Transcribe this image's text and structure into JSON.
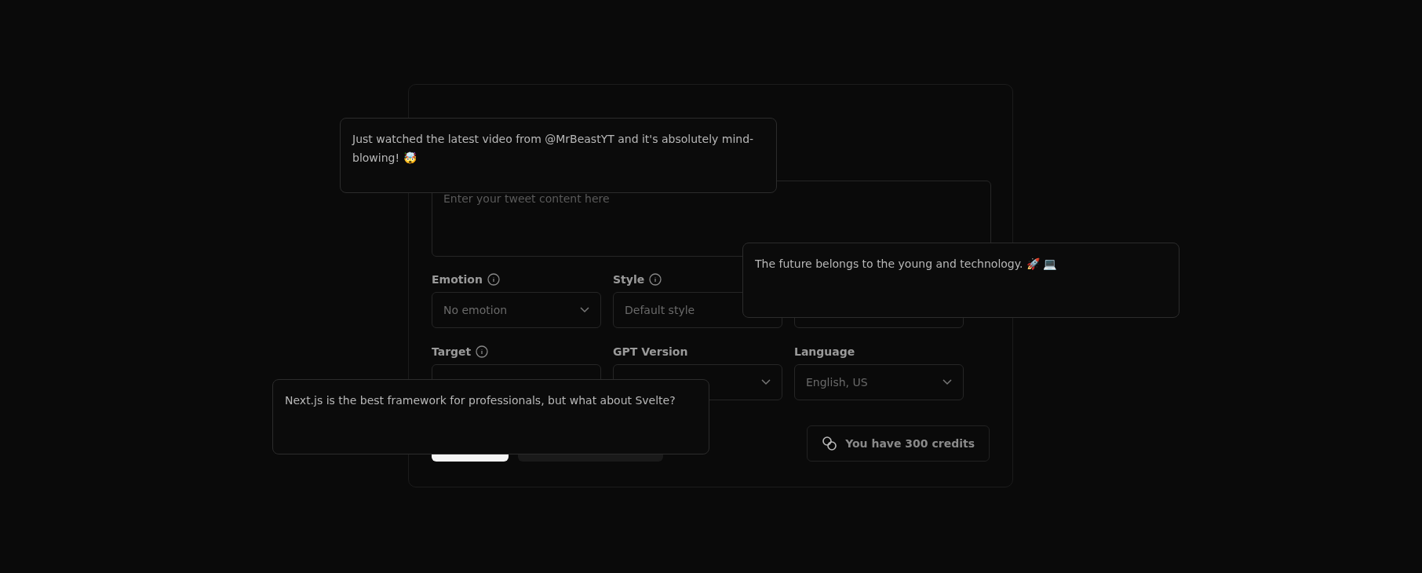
{
  "form": {
    "tweet_field": {
      "placeholder": "Enter your tweet content here"
    },
    "fields": [
      {
        "kind": "select",
        "label": "Emotion",
        "info": true,
        "value": "No emotion"
      },
      {
        "kind": "select",
        "label": "Style",
        "info": true,
        "value": "Default style"
      },
      {
        "kind": "select"
      },
      {
        "kind": "select",
        "label": "Target",
        "info": true
      },
      {
        "kind": "select",
        "label": "GPT Version",
        "info": false
      },
      {
        "kind": "select",
        "label": "Language",
        "info": false,
        "value": "English, US"
      }
    ],
    "credits": "You have 300 credits"
  },
  "tweets": [
    {
      "text": "Just watched the latest video from @MrBeastYT and it's absolutely mind-blowing! 🤯"
    },
    {
      "text": "The future belongs to the young and technology. 🚀 💻"
    },
    {
      "text": "Next.js is the best framework for professionals, but what about Svelte?"
    }
  ]
}
